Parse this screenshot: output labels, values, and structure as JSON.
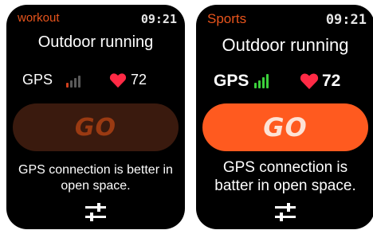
{
  "screens": [
    {
      "app_name": "workout",
      "time": "09:21",
      "title": "Outdoor running",
      "gps_label": "GPS",
      "gps_signal_bars": 1,
      "heart_rate": "72",
      "go_label": "GO",
      "hint": "GPS connection is better in open space.",
      "icons": {
        "heart": "heart-icon",
        "settings": "sliders-icon",
        "signal": "signal-bars-icon"
      }
    },
    {
      "app_name": "Sports",
      "time": "09:21",
      "title": "Outdoor running",
      "gps_label": "GPS",
      "gps_signal_bars": 4,
      "heart_rate": "72",
      "go_label": "GO",
      "hint": "GPS connection is batter in open space.",
      "icons": {
        "heart": "heart-icon",
        "settings": "sliders-icon",
        "signal": "signal-bars-icon"
      }
    }
  ],
  "colors": {
    "accent": "#e8541c",
    "go_active": "#ff5a1f",
    "go_inactive": "#3a1a0e",
    "heart": "#ff2a45",
    "signal_on": "#3bd13b",
    "signal_weak": "#d2401e",
    "signal_off": "#5a5a5a"
  }
}
